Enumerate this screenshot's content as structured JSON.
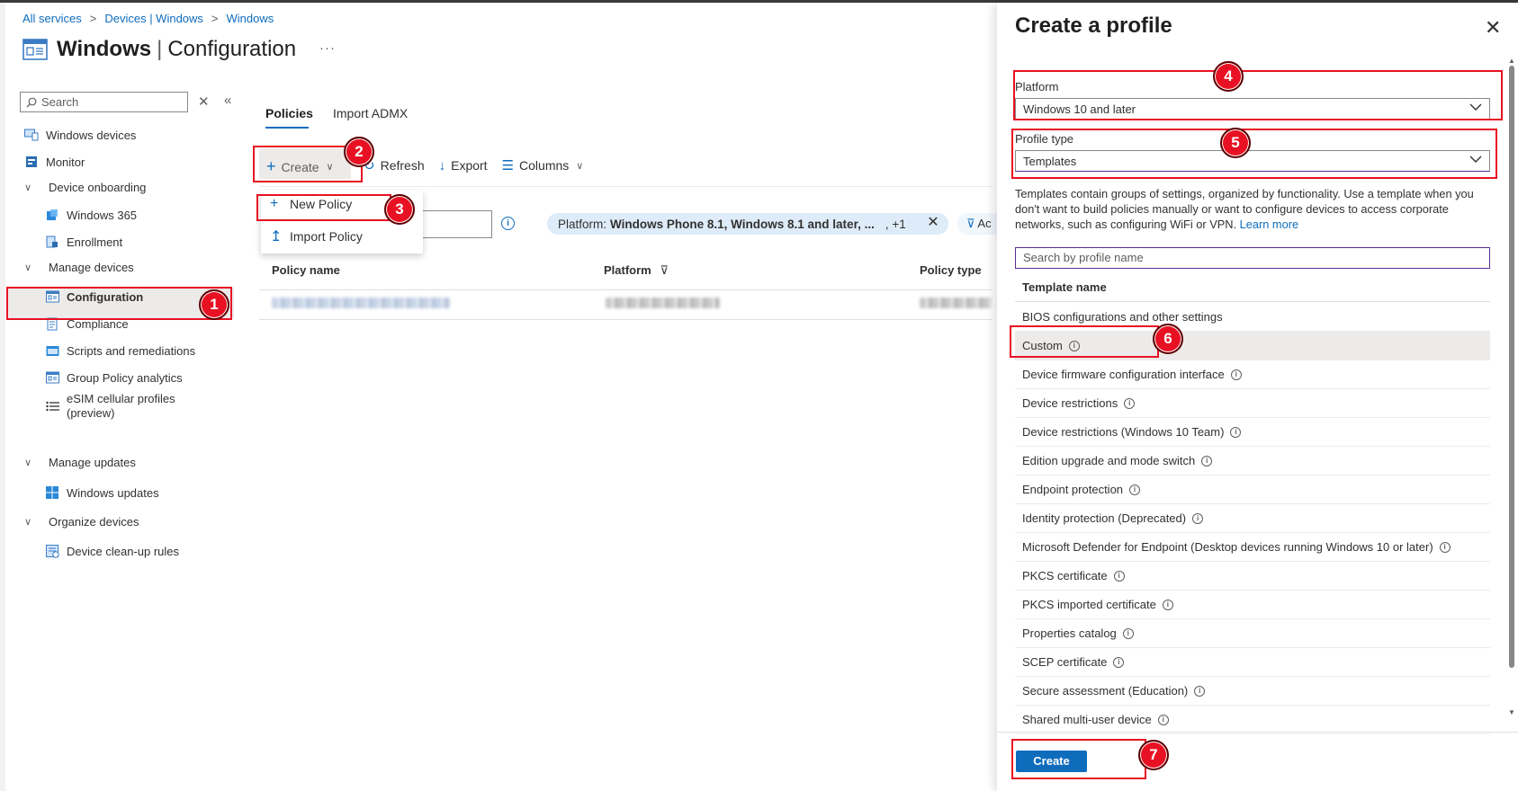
{
  "breadcrumb": [
    "All services",
    "Devices | Windows",
    "Windows"
  ],
  "page": {
    "title_main": "Windows",
    "title_sub": "Configuration",
    "more": "···"
  },
  "nav": {
    "search_placeholder": "Search",
    "items": {
      "windows_devices": "Windows devices",
      "monitor": "Monitor",
      "device_onboarding": "Device onboarding",
      "windows_365": "Windows 365",
      "enrollment": "Enrollment",
      "manage_devices": "Manage devices",
      "configuration": "Configuration",
      "compliance": "Compliance",
      "scripts": "Scripts and remediations",
      "gp_analytics": "Group Policy analytics",
      "esim_line1": "eSIM cellular profiles",
      "esim_line2": "(preview)",
      "manage_updates": "Manage updates",
      "windows_updates": "Windows updates",
      "organize_devices": "Organize devices",
      "cleanup_rules": "Device clean-up rules"
    }
  },
  "tabs": [
    "Policies",
    "Import ADMX"
  ],
  "toolbar": {
    "create": "Create",
    "refresh": "Refresh",
    "export": "Export",
    "columns": "Columns"
  },
  "create_menu": {
    "new_policy": "New Policy",
    "import_policy": "Import Policy"
  },
  "filter": {
    "label": "Platform:",
    "value": "Windows Phone 8.1, Windows 8.1 and later, ...",
    "more": ", +1",
    "add": "Ac"
  },
  "table": {
    "columns": [
      "Policy name",
      "Platform",
      "Policy type"
    ]
  },
  "panel": {
    "title": "Create a profile",
    "platform_label": "Platform",
    "platform_value": "Windows 10 and later",
    "profile_type_label": "Profile type",
    "profile_type_value": "Templates",
    "description": "Templates contain groups of settings, organized by functionality. Use a template when you don't want to build policies manually or want to configure devices to access corporate networks, such as configuring WiFi or VPN.",
    "learn_more": "Learn more",
    "search_placeholder": "Search by profile name",
    "template_header": "Template name",
    "templates": [
      "BIOS configurations and other settings",
      "Custom",
      "Device firmware configuration interface",
      "Device restrictions",
      "Device restrictions (Windows 10 Team)",
      "Edition upgrade and mode switch",
      "Endpoint protection",
      "Identity protection (Deprecated)",
      "Microsoft Defender for Endpoint (Desktop devices running Windows 10 or later)",
      "PKCS certificate",
      "PKCS imported certificate",
      "Properties catalog",
      "SCEP certificate",
      "Secure assessment (Education)",
      "Shared multi-user device"
    ],
    "create_button": "Create"
  },
  "annotations": [
    "1",
    "2",
    "3",
    "4",
    "5",
    "6",
    "7"
  ],
  "colors": {
    "accent": "#0f6cbd",
    "annotation": "#e81123",
    "selected": "#edebe9",
    "pill": "#deecf9"
  }
}
